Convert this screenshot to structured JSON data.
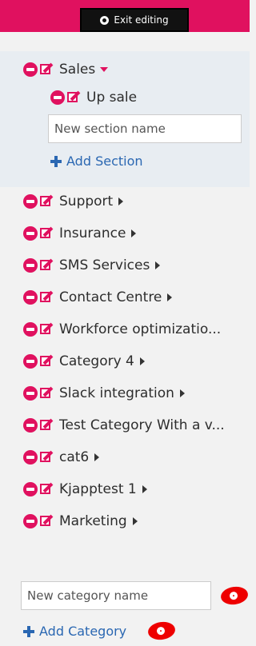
{
  "header": {
    "exit_label": "Exit editing"
  },
  "sales": {
    "label": "Sales",
    "subsection": "Up sale",
    "new_section_placeholder": "New section name",
    "add_section_label": "Add Section"
  },
  "categories": [
    "Support",
    "Insurance",
    "SMS Services",
    "Contact Centre",
    "Workforce optimizatio...",
    "Category 4",
    "Slack integration",
    "Test Category With a v...",
    "cat6",
    "Kjapptest 1",
    "Marketing"
  ],
  "footer": {
    "new_category_placeholder": "New category name",
    "add_category_label": "Add Category"
  },
  "colors": {
    "accent": "#e0115f",
    "link": "#2a67b2",
    "hint": "#e00"
  }
}
